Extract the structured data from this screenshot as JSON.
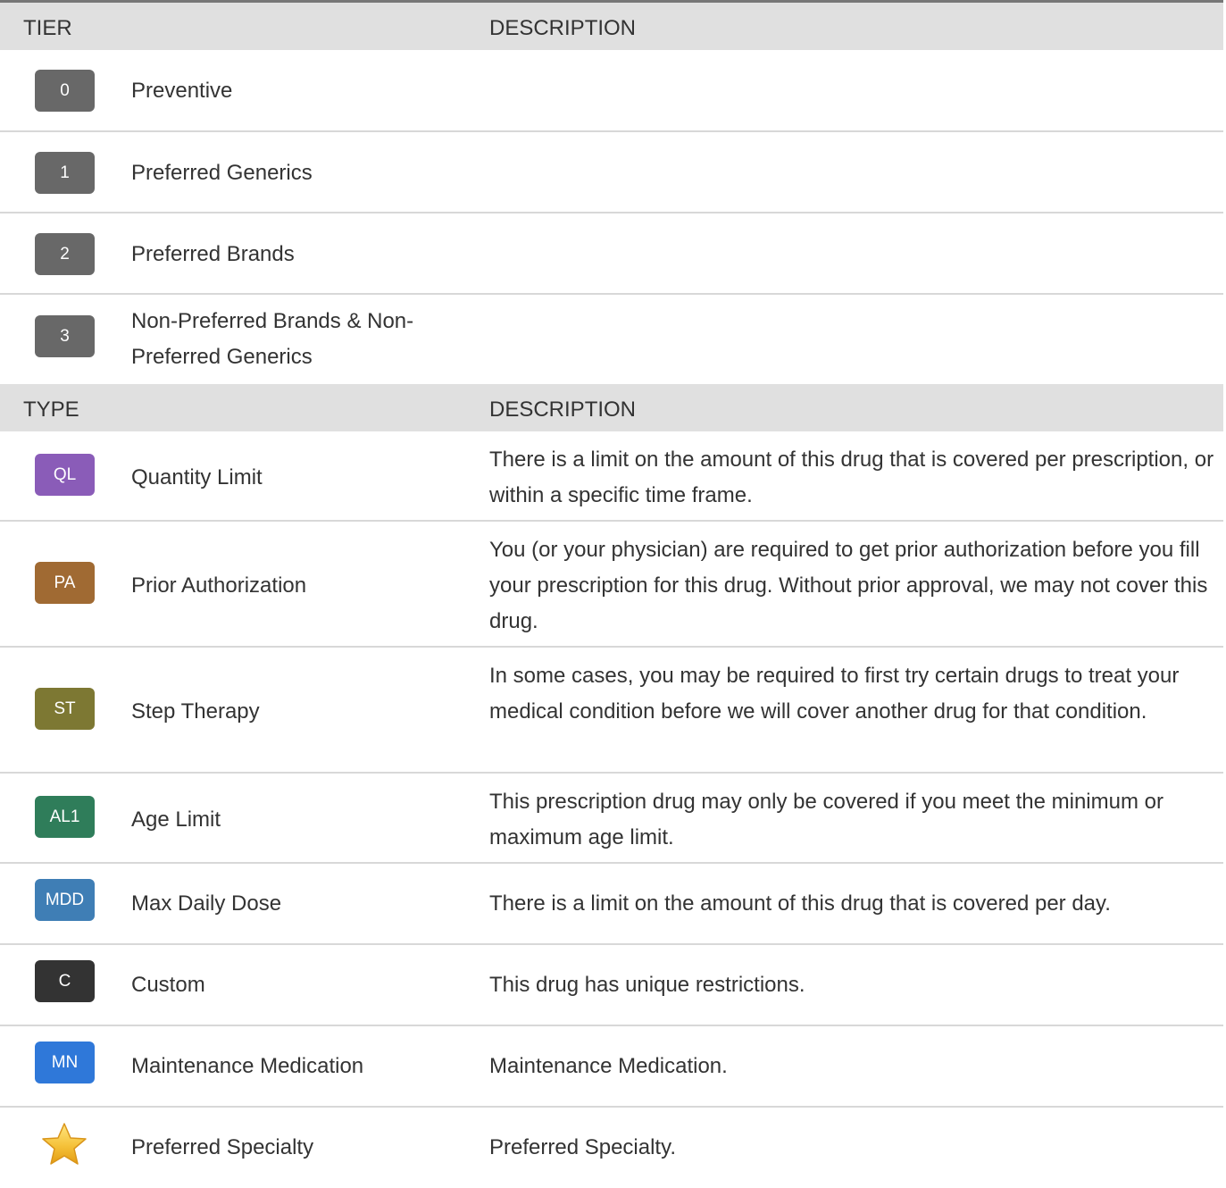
{
  "tier_section": {
    "header": {
      "col1": "TIER",
      "col2": "DESCRIPTION"
    },
    "rows": [
      {
        "badge": "0",
        "label": "Preventive"
      },
      {
        "badge": "1",
        "label": "Preferred Generics"
      },
      {
        "badge": "2",
        "label": "Preferred Brands"
      },
      {
        "badge": "3",
        "label_line1": "Non-Preferred Brands & Non-",
        "label_line2": "Preferred Generics"
      }
    ]
  },
  "type_section": {
    "header": {
      "col1": "TYPE",
      "col2": "DESCRIPTION"
    },
    "rows": [
      {
        "badge": "QL",
        "label": "Quantity Limit",
        "description": "There is a limit on the amount of this drug that is covered per prescription, or within a specific time frame."
      },
      {
        "badge": "PA",
        "label": "Prior Authorization",
        "description": "You (or your physician) are required to get prior authorization before you fill your prescription for this drug. Without prior approval, we may not cover this drug."
      },
      {
        "badge": "ST",
        "label": "Step Therapy",
        "description": "In some cases, you may be required to first try certain drugs to treat your medical condition before we will cover another drug for that condition."
      },
      {
        "badge": "AL1",
        "label": "Age Limit",
        "description": "This prescription drug may only be covered if you meet the minimum or maximum age limit."
      },
      {
        "badge": "MDD",
        "label": "Max Daily Dose",
        "description": "There is a limit on the amount of this drug that is covered per day."
      },
      {
        "badge": "C",
        "label": "Custom",
        "description": "This drug has unique restrictions."
      },
      {
        "badge": "MN",
        "label": "Maintenance Medication",
        "description": "Maintenance Medication."
      },
      {
        "icon": "star-icon",
        "label": "Preferred Specialty",
        "description": "Preferred Specialty."
      }
    ]
  },
  "colors": {
    "tier_badge": "#686868",
    "QL": "#8a5cb8",
    "PA": "#a06a33",
    "ST": "#7d7833",
    "AL1": "#2f7d5a",
    "MDD": "#3f7eb5",
    "C": "#333333",
    "MN": "#2f78d9",
    "header_bg": "#e0e0e0",
    "top_rule": "#777777",
    "divider": "#d8d8d8"
  }
}
